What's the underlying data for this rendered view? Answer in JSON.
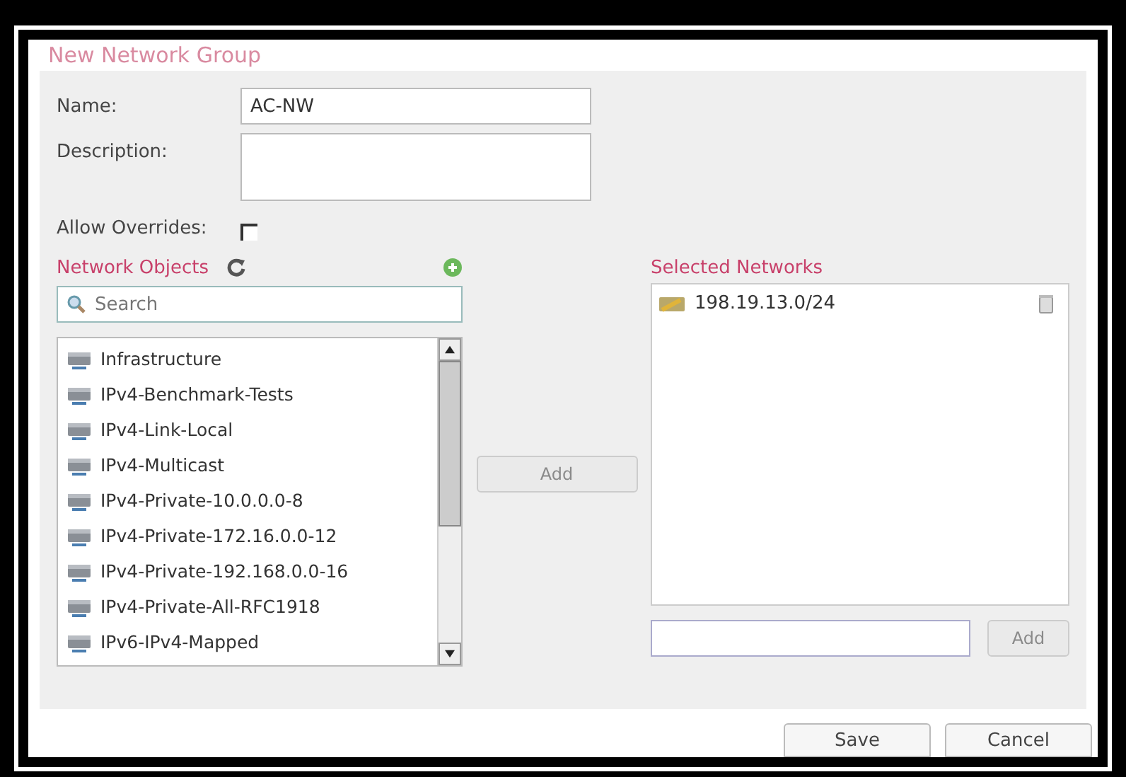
{
  "dialog": {
    "title": "New Network Group"
  },
  "form": {
    "name_label": "Name:",
    "name_value": "AC-NW",
    "description_label": "Description:",
    "overrides_label": "Allow Overrides:",
    "allow_overrides": false
  },
  "network_objects": {
    "title": "Network Objects",
    "search_placeholder": "Search",
    "items": [
      "Infrastructure",
      "IPv4-Benchmark-Tests",
      "IPv4-Link-Local",
      "IPv4-Multicast",
      "IPv4-Private-10.0.0.0-8",
      "IPv4-Private-172.16.0.0-12",
      "IPv4-Private-192.168.0.0-16",
      "IPv4-Private-All-RFC1918",
      "IPv6-IPv4-Mapped"
    ]
  },
  "add_button": {
    "label": "Add",
    "disabled": true
  },
  "selected_networks": {
    "title": "Selected Networks",
    "items": [
      "198.19.13.0/24"
    ],
    "add_label": "Add",
    "add_disabled": true
  },
  "buttons": [
    "Save",
    "Cancel"
  ]
}
